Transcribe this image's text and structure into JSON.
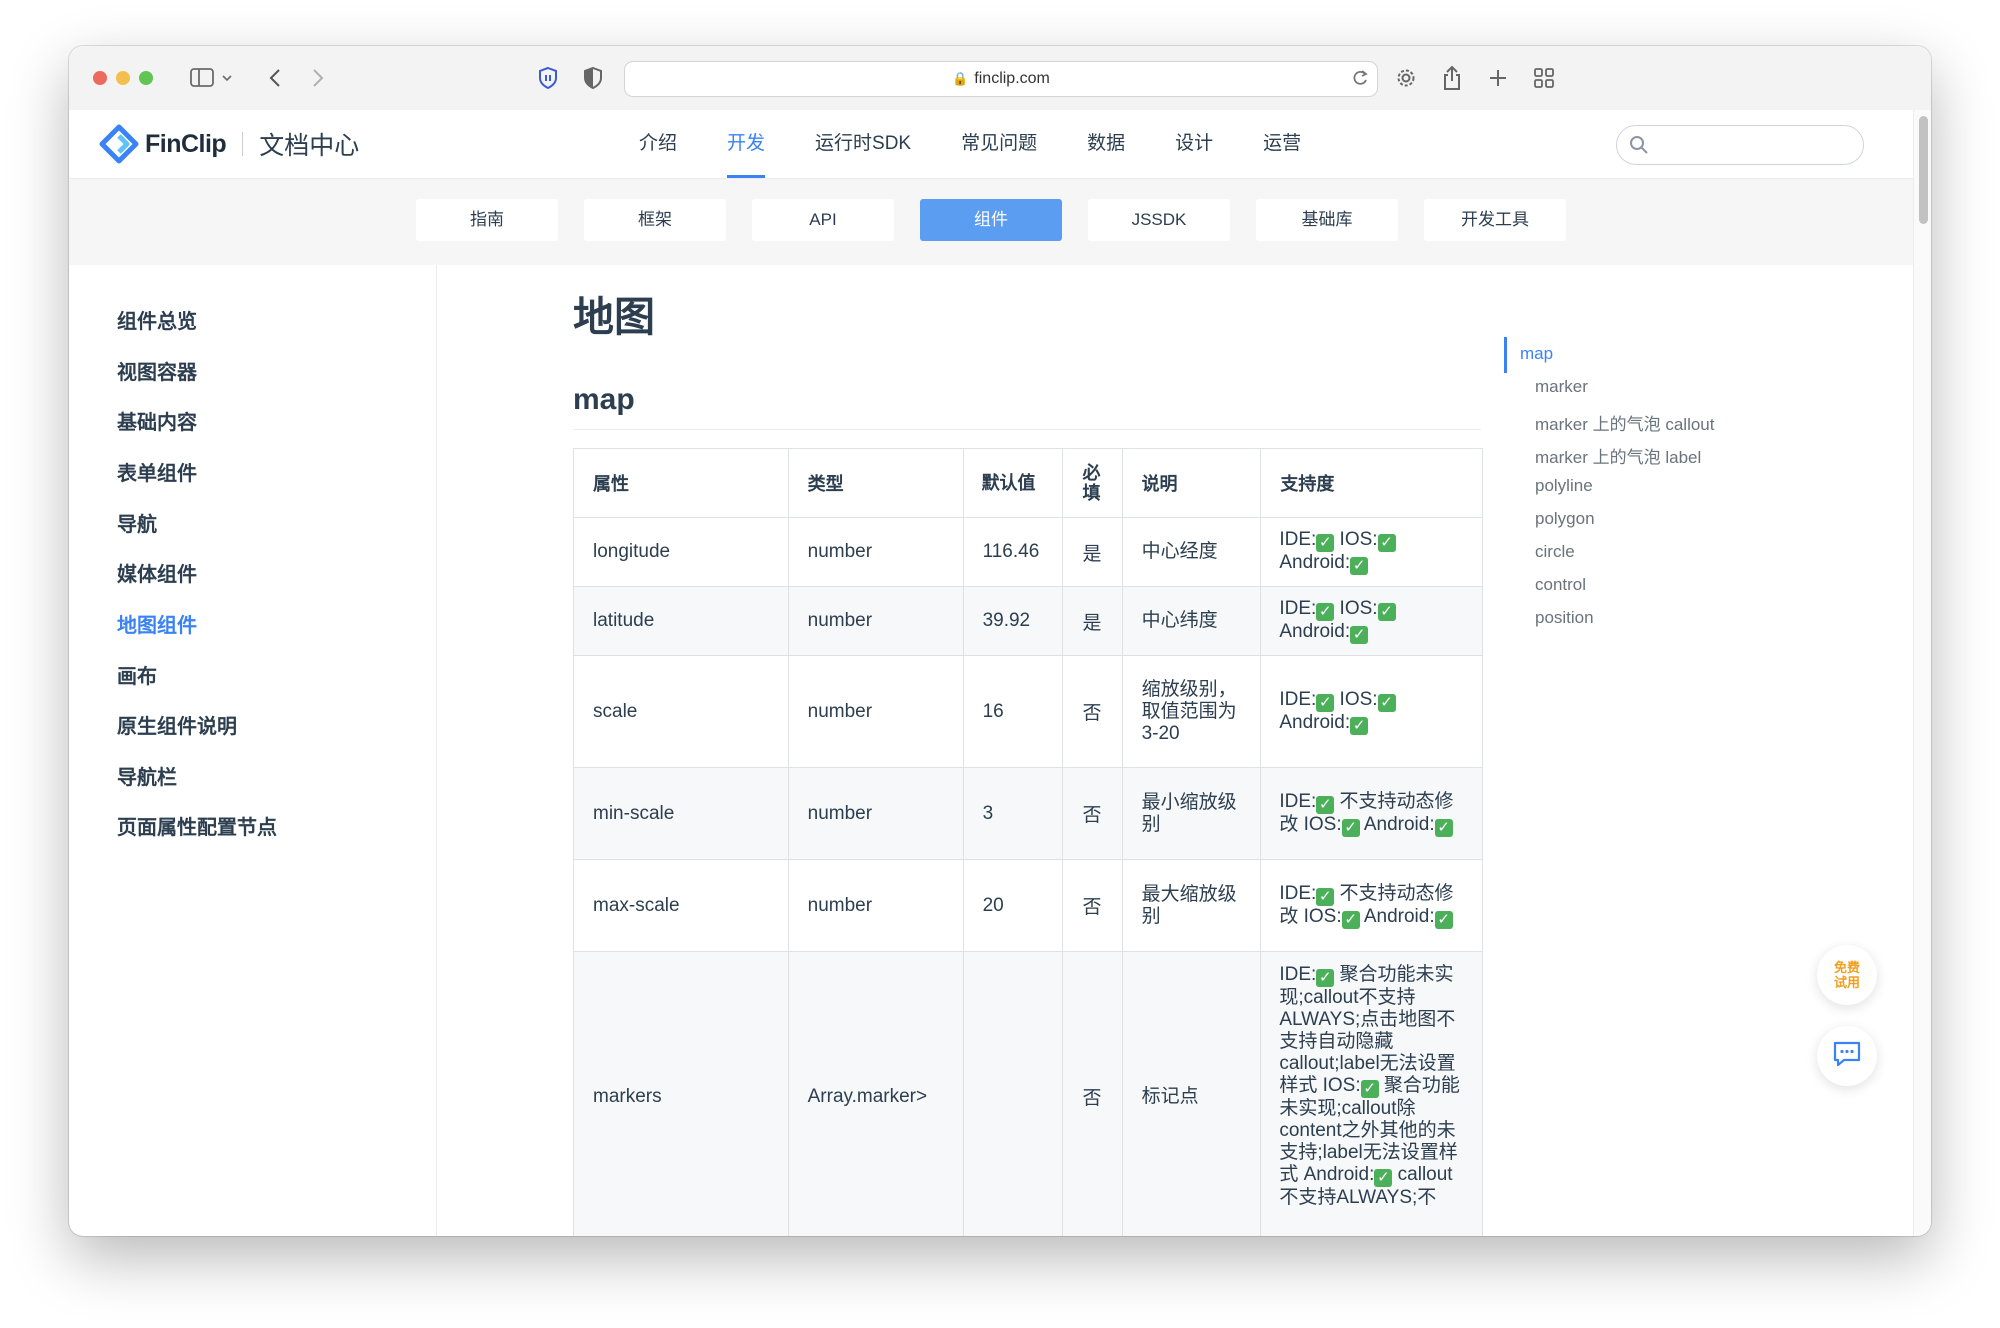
{
  "browser": {
    "url": "finclip.com"
  },
  "header": {
    "logo_text": "FinClip",
    "doc_center": "文档中心",
    "nav": [
      "介绍",
      "开发",
      "运行时SDK",
      "常见问题",
      "数据",
      "设计",
      "运营"
    ],
    "active_nav": "开发"
  },
  "subnav": {
    "tabs": [
      "指南",
      "框架",
      "API",
      "组件",
      "JSSDK",
      "基础库",
      "开发工具"
    ],
    "active": "组件"
  },
  "sidebar": {
    "items": [
      "组件总览",
      "视图容器",
      "基础内容",
      "表单组件",
      "导航",
      "媒体组件",
      "地图组件",
      "画布",
      "原生组件说明",
      "导航栏",
      "页面属性配置节点"
    ],
    "active": "地图组件"
  },
  "content": {
    "page_title": "地图",
    "section_title": "map",
    "table": {
      "headers": [
        "属性",
        "类型",
        "默认值",
        "必填",
        "说明",
        "支持度"
      ],
      "rows": [
        {
          "prop": "longitude",
          "type": "number",
          "default": "116.46",
          "required": "是",
          "desc": "中心经度",
          "support": [
            "IDE:",
            "✓",
            " IOS:",
            "✓",
            " Android:",
            "✓"
          ]
        },
        {
          "prop": "latitude",
          "type": "number",
          "default": "39.92",
          "required": "是",
          "desc": "中心纬度",
          "support": [
            "IDE:",
            "✓",
            " IOS:",
            "✓",
            " Android:",
            "✓"
          ]
        },
        {
          "prop": "scale",
          "type": "number",
          "default": "16",
          "required": "否",
          "desc": "缩放级别，取值范围为3-20",
          "support": [
            "IDE:",
            "✓",
            " IOS:",
            "✓",
            " Android:",
            "✓"
          ]
        },
        {
          "prop": "min-scale",
          "type": "number",
          "default": "3",
          "required": "否",
          "desc": "最小缩放级别",
          "support": [
            "IDE:",
            "✓",
            " 不支持动态修改 IOS:",
            "✓",
            " Android:",
            "✓"
          ]
        },
        {
          "prop": "max-scale",
          "type": "number",
          "default": "20",
          "required": "否",
          "desc": "最大缩放级别",
          "support": [
            "IDE:",
            "✓",
            " 不支持动态修改 IOS:",
            "✓",
            " Android:",
            "✓"
          ]
        },
        {
          "prop": "markers",
          "type": "Array.marker>",
          "default": "",
          "required": "否",
          "desc": "标记点",
          "support": [
            "IDE:",
            "✓",
            " 聚合功能未实现;callout不支持ALWAYS;点击地图不支持自动隐藏callout;label无法设置样式 IOS:",
            "✓",
            " 聚合功能未实现;callout除content之外其他的未支持;label无法设置样式 Android:",
            "✓",
            " callout不支持ALWAYS;不"
          ]
        }
      ]
    }
  },
  "toc": {
    "items": [
      "map",
      "marker",
      "marker 上的气泡 callout",
      "marker 上的气泡 label",
      "polyline",
      "polygon",
      "circle",
      "control",
      "position"
    ],
    "active": "map"
  },
  "floating": {
    "trial_label": "免费试用"
  },
  "colors": {
    "accent": "#3a82f6",
    "check": "#4cb05a",
    "trial": "#f0a020"
  }
}
